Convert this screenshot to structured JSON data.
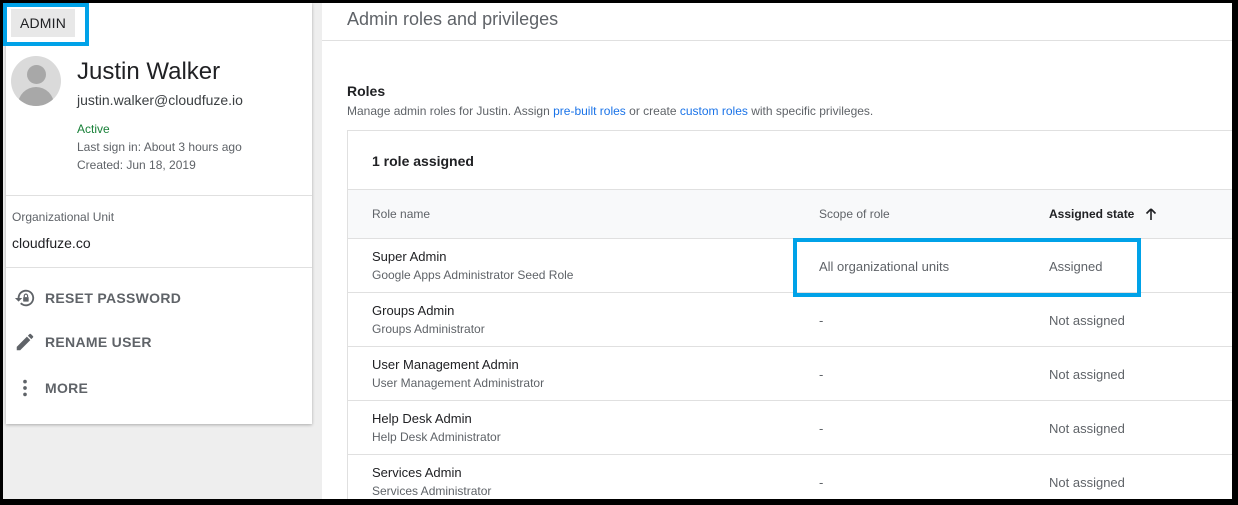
{
  "user": {
    "chip_label": "ADMIN",
    "name": "Justin Walker",
    "email": "justin.walker@cloudfuze.io",
    "status": "Active",
    "last_sign_in": "Last sign in: About 3 hours ago",
    "created": "Created: Jun 18, 2019",
    "org_unit_label": "Organizational Unit",
    "org_unit_value": "cloudfuze.co",
    "actions": [
      {
        "label": "RESET PASSWORD",
        "icon": "lock-reset-icon"
      },
      {
        "label": "RENAME USER",
        "icon": "pencil-icon"
      },
      {
        "label": "MORE",
        "icon": "more-vert-icon"
      }
    ]
  },
  "main": {
    "title": "Admin roles and privileges",
    "section_title": "Roles",
    "desc_prefix": "Manage admin roles for Justin. Assign ",
    "desc_link1": "pre-built roles",
    "desc_middle": " or create ",
    "desc_link2": "custom roles",
    "desc_suffix": " with specific privileges.",
    "role_count": "1 role assigned",
    "columns": {
      "name": "Role name",
      "scope": "Scope of role",
      "state": "Assigned state"
    },
    "roles": [
      {
        "name": "Super Admin",
        "desc": "Google Apps Administrator Seed Role",
        "scope": "All organizational units",
        "state": "Assigned"
      },
      {
        "name": "Groups Admin",
        "desc": "Groups Administrator",
        "scope": "-",
        "state": "Not assigned"
      },
      {
        "name": "User Management Admin",
        "desc": "User Management Administrator",
        "scope": "-",
        "state": "Not assigned"
      },
      {
        "name": "Help Desk Admin",
        "desc": "Help Desk Administrator",
        "scope": "-",
        "state": "Not assigned"
      },
      {
        "name": "Services Admin",
        "desc": "Services Administrator",
        "scope": "-",
        "state": "Not assigned"
      }
    ]
  },
  "colors": {
    "highlight": "#00a2e8",
    "link": "#1a73e8",
    "active_status": "#188038"
  }
}
